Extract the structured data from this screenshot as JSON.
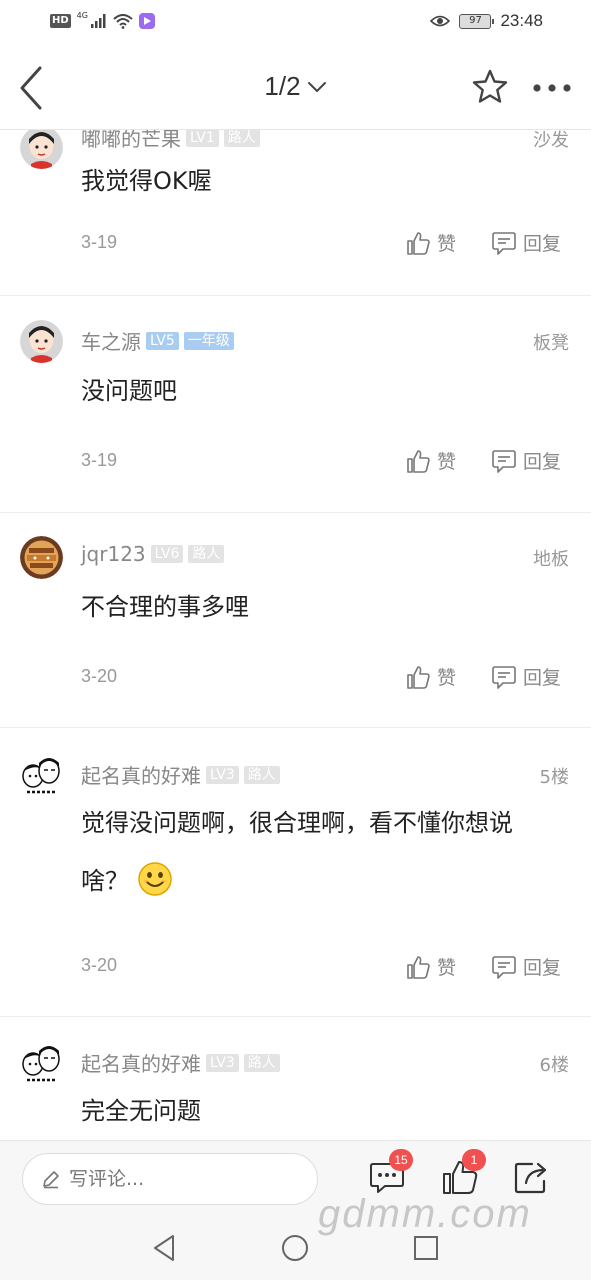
{
  "status_bar": {
    "hd_label": "HD",
    "network_label": "4G",
    "battery_level": "97",
    "time": "23:48"
  },
  "header": {
    "page_indicator": "1/2"
  },
  "comments": [
    {
      "username": "嘟嘟的芒果",
      "level": "LV1",
      "tag": "路人",
      "floor": "沙发",
      "content": "我觉得OK喔",
      "date": "3-19",
      "like_label": "赞",
      "reply_label": "回复"
    },
    {
      "username": "车之源",
      "level": "LV5",
      "tag": "一年级",
      "floor": "板凳",
      "content": "没问题吧",
      "date": "3-19",
      "like_label": "赞",
      "reply_label": "回复"
    },
    {
      "username": "jqr123",
      "level": "LV6",
      "tag": "路人",
      "floor": "地板",
      "content": "不合理的事多哩",
      "date": "3-20",
      "like_label": "赞",
      "reply_label": "回复"
    },
    {
      "username": "起名真的好难",
      "level": "LV3",
      "tag": "路人",
      "floor": "5楼",
      "content": "觉得没问题啊，很合理啊，看不懂你想说啥？",
      "date": "3-20",
      "like_label": "赞",
      "reply_label": "回复"
    },
    {
      "username": "起名真的好难",
      "level": "LV3",
      "tag": "路人",
      "floor": "6楼",
      "content": "完全无问题"
    }
  ],
  "bottom_bar": {
    "comment_placeholder": "写评论...",
    "comment_count": "15",
    "like_count": "1"
  },
  "watermark": "gdmm.com",
  "colors": {
    "badge_red": "#f0504f",
    "level_blue": "#a9cdf1",
    "muted_text": "#888888"
  }
}
